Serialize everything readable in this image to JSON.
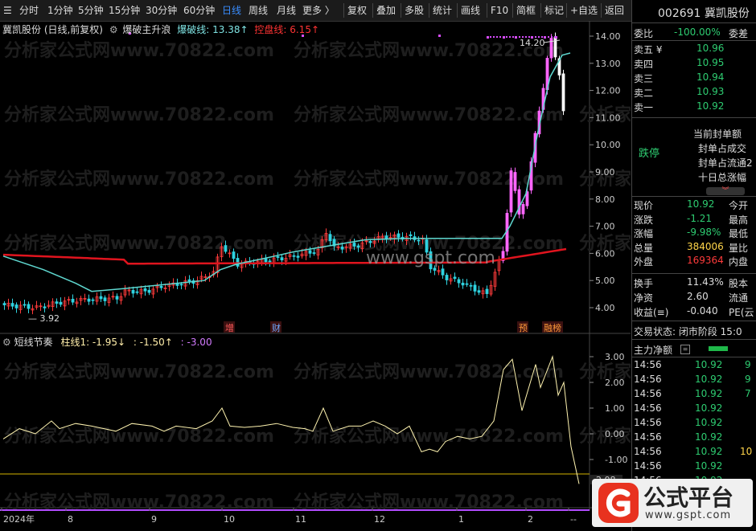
{
  "toolbar": {
    "periods": [
      "分时",
      "1分钟",
      "5分钟",
      "15分钟",
      "30分钟",
      "60分钟",
      "日线",
      "周线",
      "月线",
      "更多 〉"
    ],
    "active_period": "日线",
    "tools": [
      "复权",
      "叠加",
      "多股",
      "统计",
      "画线",
      "F10",
      "简框",
      "标记",
      "+自选",
      "返回"
    ]
  },
  "main_chart": {
    "stock_title": "冀凯股份 (日线,前复权)",
    "indicator_name": "爆破主升浪",
    "line1_label": "爆破线: 13.38↑",
    "line2_label": "控盘线: 6.15↑",
    "high_label": "14.20",
    "low_label": "3.92",
    "y_ticks": [
      "14.00",
      "13.00",
      "12.00",
      "11.00",
      "10.00",
      "9.00",
      "8.00",
      "7.00",
      "6.00",
      "5.00",
      "4.00"
    ],
    "markers": [
      "增",
      "财",
      "预",
      "融榜"
    ],
    "site_watermark": "www.gspt.com",
    "watermark_text": "分析家公式网www.70822.com"
  },
  "sub_chart": {
    "title": "短线节奏",
    "val1": "柱线1: -1.95↓",
    "val2": ": -1.50↑",
    "val3": ": -3.00",
    "y_ticks": [
      "3.00",
      "2.00",
      "1.00",
      "0.00",
      "-1.00"
    ],
    "last_label": "-2.08"
  },
  "x_axis": [
    "2024年",
    "8",
    "9",
    "10",
    "11",
    "12",
    "1",
    "2",
    "--"
  ],
  "quote": {
    "code_name": "002691 冀凯股份",
    "weibi_label": "委比",
    "weibi_value": "-100.00%",
    "weicha_label": "委差",
    "sell_levels": [
      {
        "label": "卖五 ¥",
        "price": "10.96"
      },
      {
        "label": "卖四",
        "price": "10.95"
      },
      {
        "label": "卖三",
        "price": "10.94"
      },
      {
        "label": "卖二",
        "price": "10.93"
      },
      {
        "label": "卖一",
        "price": "10.92"
      }
    ],
    "limit_down": "跌停",
    "limit_info": [
      "当前封单额",
      "封单占成交",
      "封单占流通2",
      "十日总涨幅"
    ],
    "stats": [
      {
        "l1": "现价",
        "v1": "10.92",
        "l2": "今开",
        "c": "#2ecc71"
      },
      {
        "l1": "涨跌",
        "v1": "-1.21",
        "l2": "最高",
        "c": "#2ecc71"
      },
      {
        "l1": "涨幅",
        "v1": "-9.98%",
        "l2": "最低",
        "c": "#2ecc71"
      },
      {
        "l1": "总量",
        "v1": "384006",
        "l2": "量比",
        "c": "#ffd54a"
      },
      {
        "l1": "外盘",
        "v1": "169364",
        "l2": "内盘",
        "c": "#ff3b3b"
      }
    ],
    "stats2": [
      {
        "l1": "换手",
        "v1": "11.43%",
        "l2": "股本"
      },
      {
        "l1": "净资",
        "v1": "2.60",
        "l2": "流通"
      },
      {
        "l1": "收益(≡)",
        "v1": "-0.040",
        "l2": "PE(云"
      }
    ],
    "trade_status": "交易状态: 闭市阶段 15:0",
    "main_fund": "主力净额",
    "ticks": [
      {
        "t": "14:56",
        "p": "10.92",
        "v": "9"
      },
      {
        "t": "14:56",
        "p": "10.92",
        "v": "9"
      },
      {
        "t": "14:56",
        "p": "10.92",
        "v": "7"
      },
      {
        "t": "14:56",
        "p": "10.92",
        "v": ""
      },
      {
        "t": "14:56",
        "p": "10.92",
        "v": ""
      },
      {
        "t": "14:56",
        "p": "10.92",
        "v": ""
      },
      {
        "t": "14:56",
        "p": "10.92",
        "v": "10"
      },
      {
        "t": "14:56",
        "p": "10.92",
        "v": ""
      },
      {
        "t": "14:56",
        "p": "10.92",
        "v": ""
      }
    ]
  },
  "logo": {
    "text": "公式平台",
    "url": "www.gspt.com"
  }
}
